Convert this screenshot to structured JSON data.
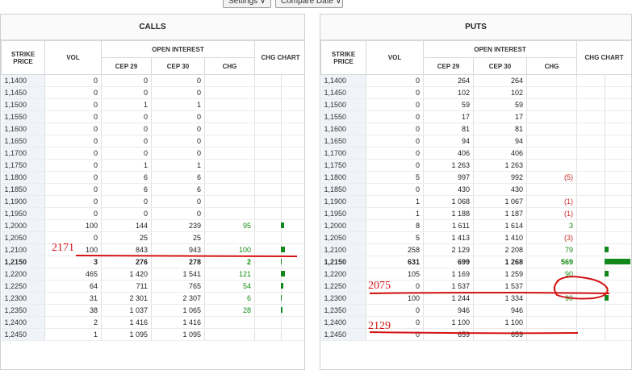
{
  "toolbar": {
    "settings_label": "Settings ∨",
    "compare_label": "Compare Date ∨"
  },
  "calls": {
    "title": "CALLS",
    "headers": {
      "strike": "STRIKE PRICE",
      "vol": "VOL",
      "open_interest": "OPEN INTEREST",
      "cep29": "CEP 29",
      "cep30": "CEP 30",
      "chg": "CHG",
      "chart": "CHG CHART"
    },
    "rows": [
      {
        "strike": "1,1400",
        "vol": "0",
        "c29": "0",
        "c30": "0",
        "chg": "",
        "bar": 0
      },
      {
        "strike": "1,1450",
        "vol": "0",
        "c29": "0",
        "c30": "0",
        "chg": "",
        "bar": 0
      },
      {
        "strike": "1,1500",
        "vol": "0",
        "c29": "1",
        "c30": "1",
        "chg": "",
        "bar": 0
      },
      {
        "strike": "1,1550",
        "vol": "0",
        "c29": "0",
        "c30": "0",
        "chg": "",
        "bar": 0
      },
      {
        "strike": "1,1600",
        "vol": "0",
        "c29": "0",
        "c30": "0",
        "chg": "",
        "bar": 0
      },
      {
        "strike": "1,1650",
        "vol": "0",
        "c29": "0",
        "c30": "0",
        "chg": "",
        "bar": 0
      },
      {
        "strike": "1,1700",
        "vol": "0",
        "c29": "0",
        "c30": "0",
        "chg": "",
        "bar": 0
      },
      {
        "strike": "1,1750",
        "vol": "0",
        "c29": "1",
        "c30": "1",
        "chg": "",
        "bar": 0
      },
      {
        "strike": "1,1800",
        "vol": "0",
        "c29": "6",
        "c30": "6",
        "chg": "",
        "bar": 0
      },
      {
        "strike": "1,1850",
        "vol": "0",
        "c29": "6",
        "c30": "6",
        "chg": "",
        "bar": 0
      },
      {
        "strike": "1,1900",
        "vol": "0",
        "c29": "0",
        "c30": "0",
        "chg": "",
        "bar": 0
      },
      {
        "strike": "1,1950",
        "vol": "0",
        "c29": "0",
        "c30": "0",
        "chg": "",
        "bar": 0
      },
      {
        "strike": "1,2000",
        "vol": "100",
        "c29": "144",
        "c30": "239",
        "chg": "95",
        "bar": 95
      },
      {
        "strike": "1,2050",
        "vol": "0",
        "c29": "25",
        "c30": "25",
        "chg": "",
        "bar": 0
      },
      {
        "strike": "1,2100",
        "vol": "100",
        "c29": "843",
        "c30": "943",
        "chg": "100",
        "bar": 100
      },
      {
        "strike": "1,2150",
        "vol": "3",
        "c29": "276",
        "c30": "278",
        "chg": "2",
        "bar": 2,
        "bold": true
      },
      {
        "strike": "1,2200",
        "vol": "465",
        "c29": "1 420",
        "c30": "1 541",
        "chg": "121",
        "bar": 121
      },
      {
        "strike": "1,2250",
        "vol": "64",
        "c29": "711",
        "c30": "765",
        "chg": "54",
        "bar": 54
      },
      {
        "strike": "1,2300",
        "vol": "31",
        "c29": "2 301",
        "c30": "2 307",
        "chg": "6",
        "bar": 6
      },
      {
        "strike": "1,2350",
        "vol": "38",
        "c29": "1 037",
        "c30": "1 065",
        "chg": "28",
        "bar": 28
      },
      {
        "strike": "1,2400",
        "vol": "2",
        "c29": "1 416",
        "c30": "1 416",
        "chg": "",
        "bar": 0
      },
      {
        "strike": "1,2450",
        "vol": "1",
        "c29": "1 095",
        "c30": "1 095",
        "chg": "",
        "bar": 0
      }
    ]
  },
  "puts": {
    "title": "PUTS",
    "headers": {
      "strike": "STRIKE PRICE",
      "vol": "VOL",
      "open_interest": "OPEN INTEREST",
      "cep29": "CEP 29",
      "cep30": "CEP 30",
      "chg": "CHG",
      "chart": "CHG CHART"
    },
    "rows": [
      {
        "strike": "1,1400",
        "vol": "0",
        "c29": "264",
        "c30": "264",
        "chg": "",
        "bar": 0
      },
      {
        "strike": "1,1450",
        "vol": "0",
        "c29": "102",
        "c30": "102",
        "chg": "",
        "bar": 0
      },
      {
        "strike": "1,1500",
        "vol": "0",
        "c29": "59",
        "c30": "59",
        "chg": "",
        "bar": 0
      },
      {
        "strike": "1,1550",
        "vol": "0",
        "c29": "17",
        "c30": "17",
        "chg": "",
        "bar": 0
      },
      {
        "strike": "1,1600",
        "vol": "0",
        "c29": "81",
        "c30": "81",
        "chg": "",
        "bar": 0
      },
      {
        "strike": "1,1650",
        "vol": "0",
        "c29": "94",
        "c30": "94",
        "chg": "",
        "bar": 0
      },
      {
        "strike": "1,1700",
        "vol": "0",
        "c29": "406",
        "c30": "406",
        "chg": "",
        "bar": 0
      },
      {
        "strike": "1,1750",
        "vol": "0",
        "c29": "1 263",
        "c30": "1 263",
        "chg": "",
        "bar": 0
      },
      {
        "strike": "1,1800",
        "vol": "5",
        "c29": "997",
        "c30": "992",
        "chg": "(5)",
        "bar": 0
      },
      {
        "strike": "1,1850",
        "vol": "0",
        "c29": "430",
        "c30": "430",
        "chg": "",
        "bar": 0
      },
      {
        "strike": "1,1900",
        "vol": "1",
        "c29": "1 068",
        "c30": "1 067",
        "chg": "(1)",
        "bar": 0
      },
      {
        "strike": "1,1950",
        "vol": "1",
        "c29": "1 188",
        "c30": "1 187",
        "chg": "(1)",
        "bar": 0
      },
      {
        "strike": "1,2000",
        "vol": "8",
        "c29": "1 611",
        "c30": "1 614",
        "chg": "3",
        "bar": 0
      },
      {
        "strike": "1,2050",
        "vol": "5",
        "c29": "1 413",
        "c30": "1 410",
        "chg": "(3)",
        "bar": 0
      },
      {
        "strike": "1,2100",
        "vol": "258",
        "c29": "2 129",
        "c30": "2 208",
        "chg": "79",
        "bar": 79
      },
      {
        "strike": "1,2150",
        "vol": "631",
        "c29": "699",
        "c30": "1 268",
        "chg": "569",
        "bar": 569,
        "bold": true
      },
      {
        "strike": "1,2200",
        "vol": "105",
        "c29": "1 169",
        "c30": "1 259",
        "chg": "90",
        "bar": 90
      },
      {
        "strike": "1,2250",
        "vol": "0",
        "c29": "1 537",
        "c30": "1 537",
        "chg": "",
        "bar": 0
      },
      {
        "strike": "1,2300",
        "vol": "100",
        "c29": "1 244",
        "c30": "1 334",
        "chg": "90",
        "bar": 90
      },
      {
        "strike": "1,2350",
        "vol": "0",
        "c29": "946",
        "c30": "946",
        "chg": "",
        "bar": 0
      },
      {
        "strike": "1,2400",
        "vol": "0",
        "c29": "1 100",
        "c30": "1 100",
        "chg": "",
        "bar": 0
      },
      {
        "strike": "1,2450",
        "vol": "0",
        "c29": "659",
        "c30": "659",
        "chg": "",
        "bar": 0
      }
    ]
  },
  "annotations": {
    "calls_note": "2171",
    "puts_note_1": "2075",
    "puts_note_2": "2129"
  },
  "colors": {
    "positive": "#138a13",
    "negative": "#c62828",
    "bar": "#12881c",
    "annotation": "#d31212"
  }
}
